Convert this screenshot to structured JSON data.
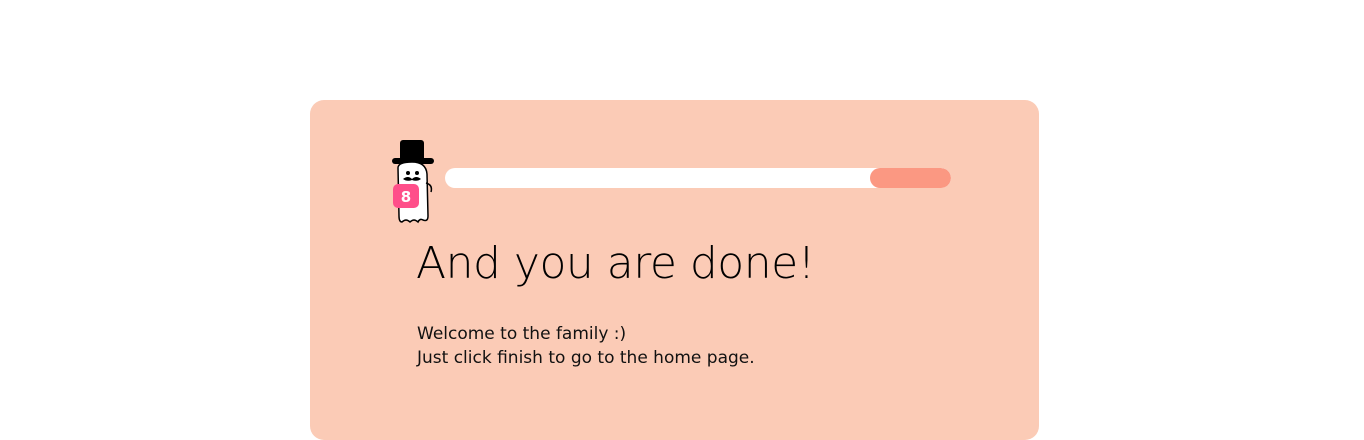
{
  "onboarding": {
    "title": "And you are done!",
    "message_line_1": "Welcome to the family :)",
    "message_line_2": "Just click finish to go to the home page.",
    "mascot": {
      "icon": "top-hat-ghost-mascot-icon",
      "badge_text": "8"
    },
    "progress": {
      "segment_start_fraction": 0.84,
      "segment_end_fraction": 1.0
    }
  },
  "colors": {
    "card_background": "#fbcbb6",
    "progress_track": "#ffffff",
    "progress_fill": "#fb9882",
    "mascot_badge": "#ff4f8a"
  }
}
